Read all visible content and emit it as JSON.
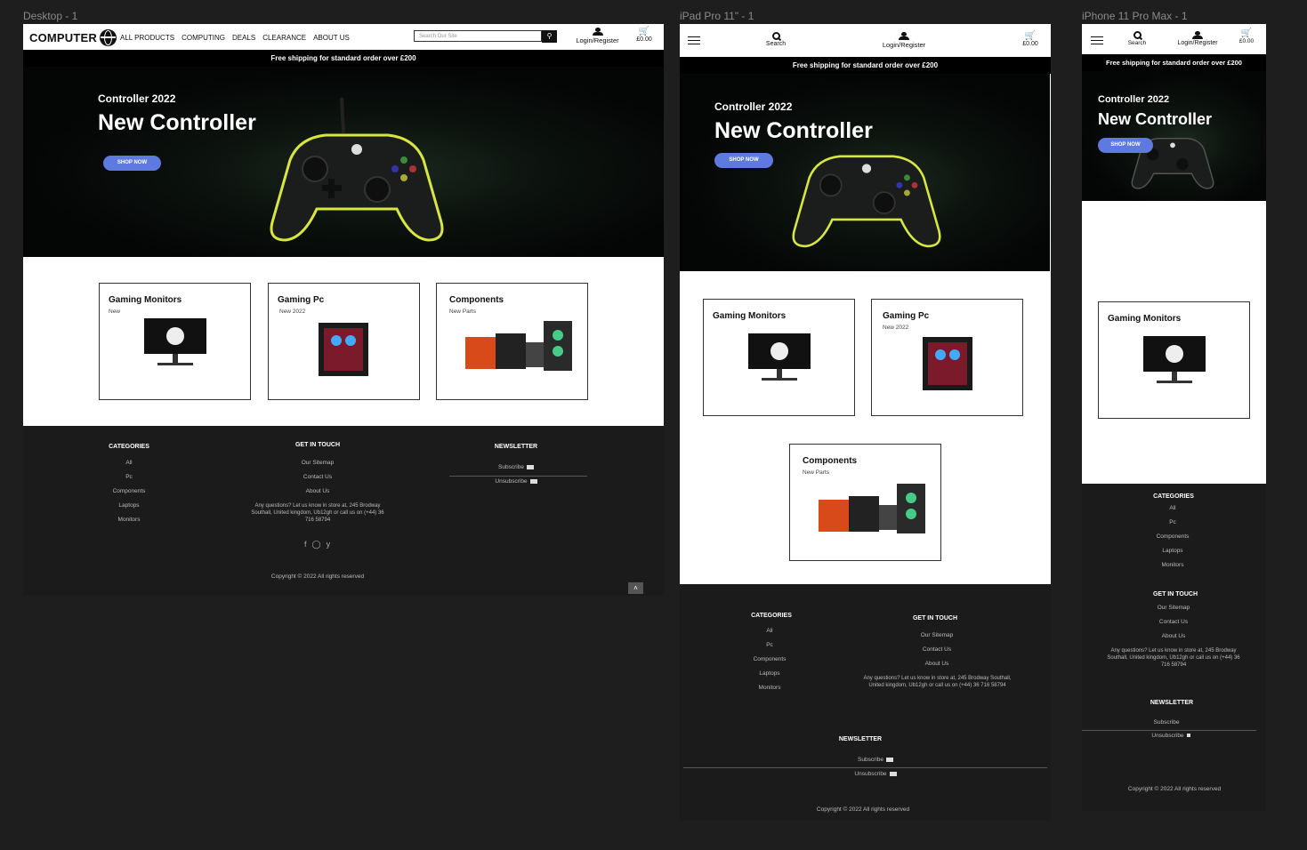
{
  "frames": {
    "desktop_label": "Desktop - 1",
    "ipad_label": "iPad Pro 11\" - 1",
    "iphone_label": "iPhone 11 Pro Max - 1"
  },
  "header": {
    "logo_text": "COMPUTER",
    "nav": [
      "ALL PRODUCTS",
      "COMPUTING",
      "DEALS",
      "CLEARANCE",
      "ABOUT US"
    ],
    "search_placeholder": "Search Our Site",
    "search_label": "Search",
    "login_label": "Login/Register",
    "cart_total": "£0.00"
  },
  "shipping_banner": "Free shipping for standard order over £200",
  "hero": {
    "subtitle": "Controller 2022",
    "title": "New Controller",
    "button": "SHOP NOW"
  },
  "cards": [
    {
      "title": "Gaming Monitors",
      "subtitle": "New"
    },
    {
      "title": "Gaming Pc",
      "subtitle": "New 2022"
    },
    {
      "title": "Components",
      "subtitle": "New Parts"
    }
  ],
  "footer": {
    "categories_heading": "CATEGORIES",
    "categories": [
      "All",
      "Pc",
      "Components",
      "Laptops",
      "Monitors"
    ],
    "contact_heading": "GET IN TOUCH",
    "contact_links": [
      "Our Sitemap",
      "Contact Us",
      "About Us"
    ],
    "address_desktop": "Any questions? Let us know in store at, 245 Brodway Southall, United kingdom, Ub12gh or call us on (+44) 36 716 58794",
    "address_ipad": "Any questions? Let us know in store at, 245 Brodway Southall, United kingdom, Ub12gh or call us on (+44) 36 716 58794",
    "address_phone": "Any questions? Let us know in store at, 245 Brodway Southall, United kingdom, Ub12gh or call us on (+44) 36 716 58794",
    "newsletter_heading": "NEWSLETTER",
    "subscribe": "Subscribe",
    "unsubscribe": "Unsubscribe",
    "social_icons": [
      "facebook-icon",
      "instagram-icon",
      "twitter-icon"
    ],
    "copyright": "Copyright © 2022 All rights reserved"
  },
  "colors": {
    "accent_button": "#5e7ae0",
    "footer_bg": "#1b1b1b",
    "canvas_bg": "#1e1e1e",
    "controller_glow": "#d8e640"
  }
}
